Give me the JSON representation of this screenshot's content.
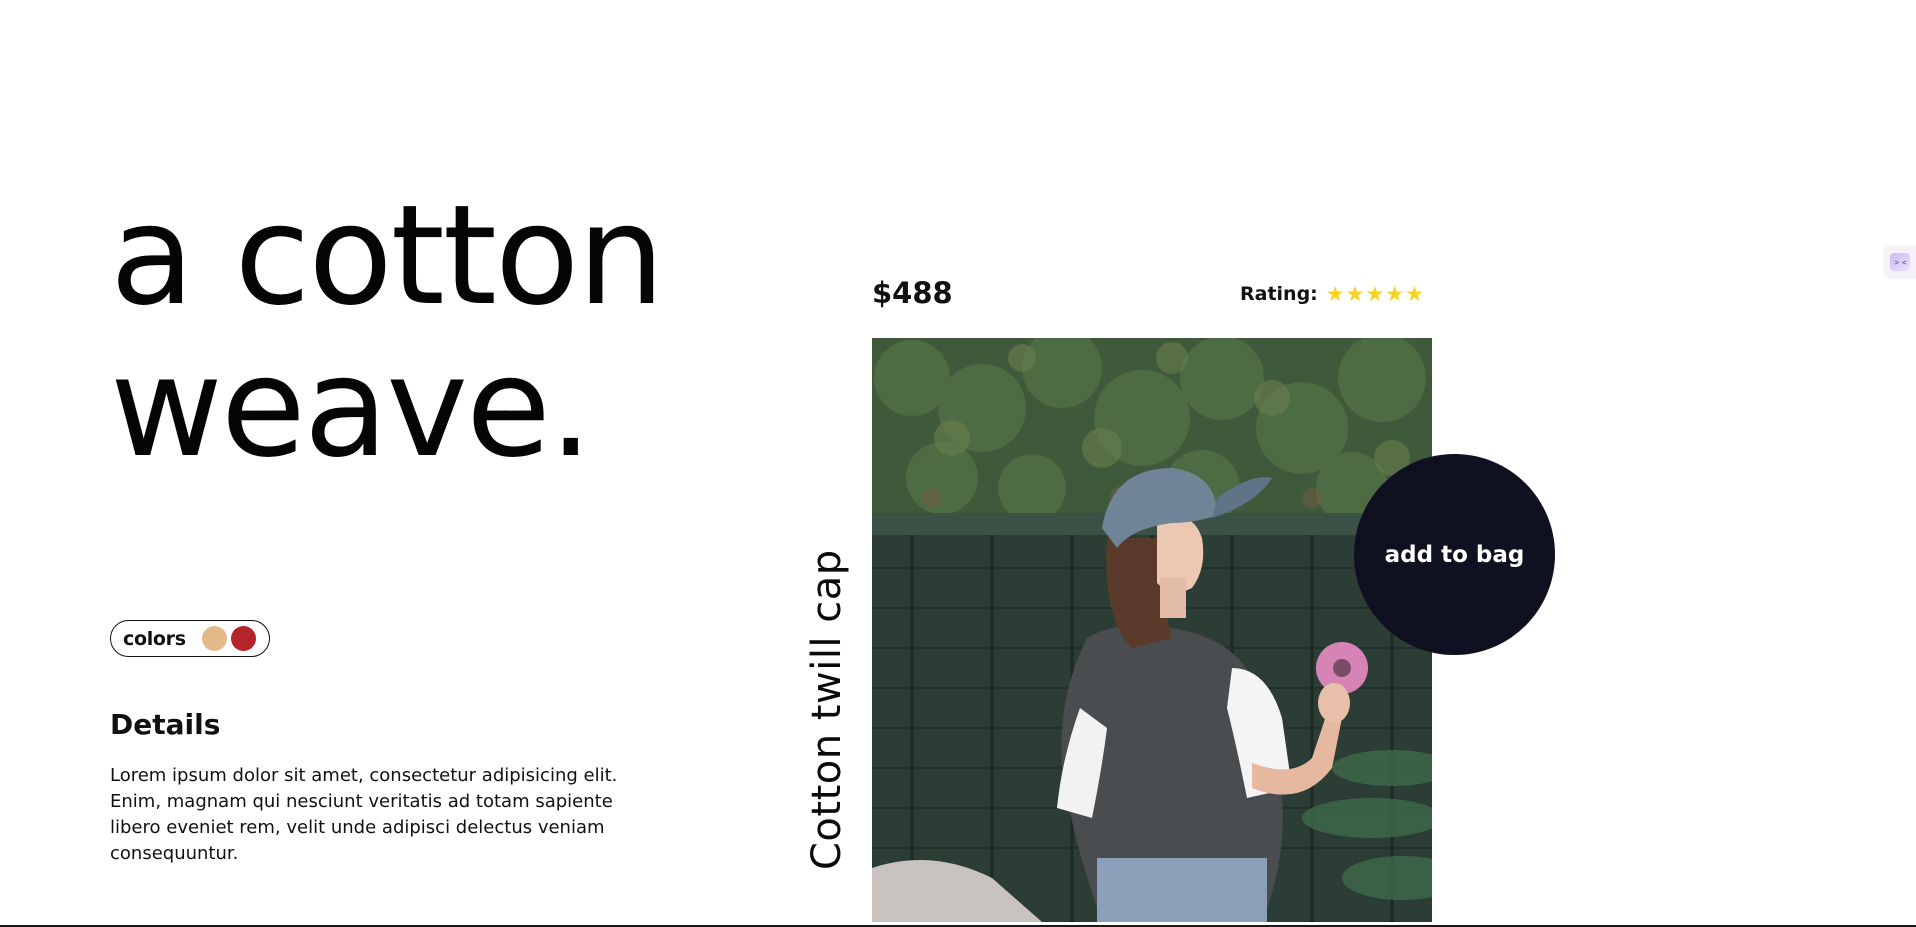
{
  "hero": {
    "line1": "a cotton",
    "line2": "weave."
  },
  "colors": {
    "label": "colors",
    "swatches": [
      {
        "name": "tan",
        "hex": "#E3B98A"
      },
      {
        "name": "red",
        "hex": "#B3252B"
      }
    ]
  },
  "details": {
    "title": "Details",
    "body": "Lorem ipsum dolor sit amet, consectetur adipisicing elit. Enim, magnam qui nesciunt veritatis ad totam sapiente libero eveniet rem, velit unde adipisci delectus veniam consequuntur."
  },
  "product": {
    "name": "Cotton twill cap",
    "price": "$488",
    "rating_label": "Rating:",
    "rating_stars": 5,
    "rating_max": 5,
    "star_glyph": "★",
    "add_to_bag": "add to bag"
  },
  "colors_theme": {
    "button_bg": "#0F1020",
    "star": "#F7D21E",
    "text": "#0C0C0C"
  },
  "icons": {
    "extension": "assistant-extension-icon",
    "extension_glyph": "> <"
  }
}
